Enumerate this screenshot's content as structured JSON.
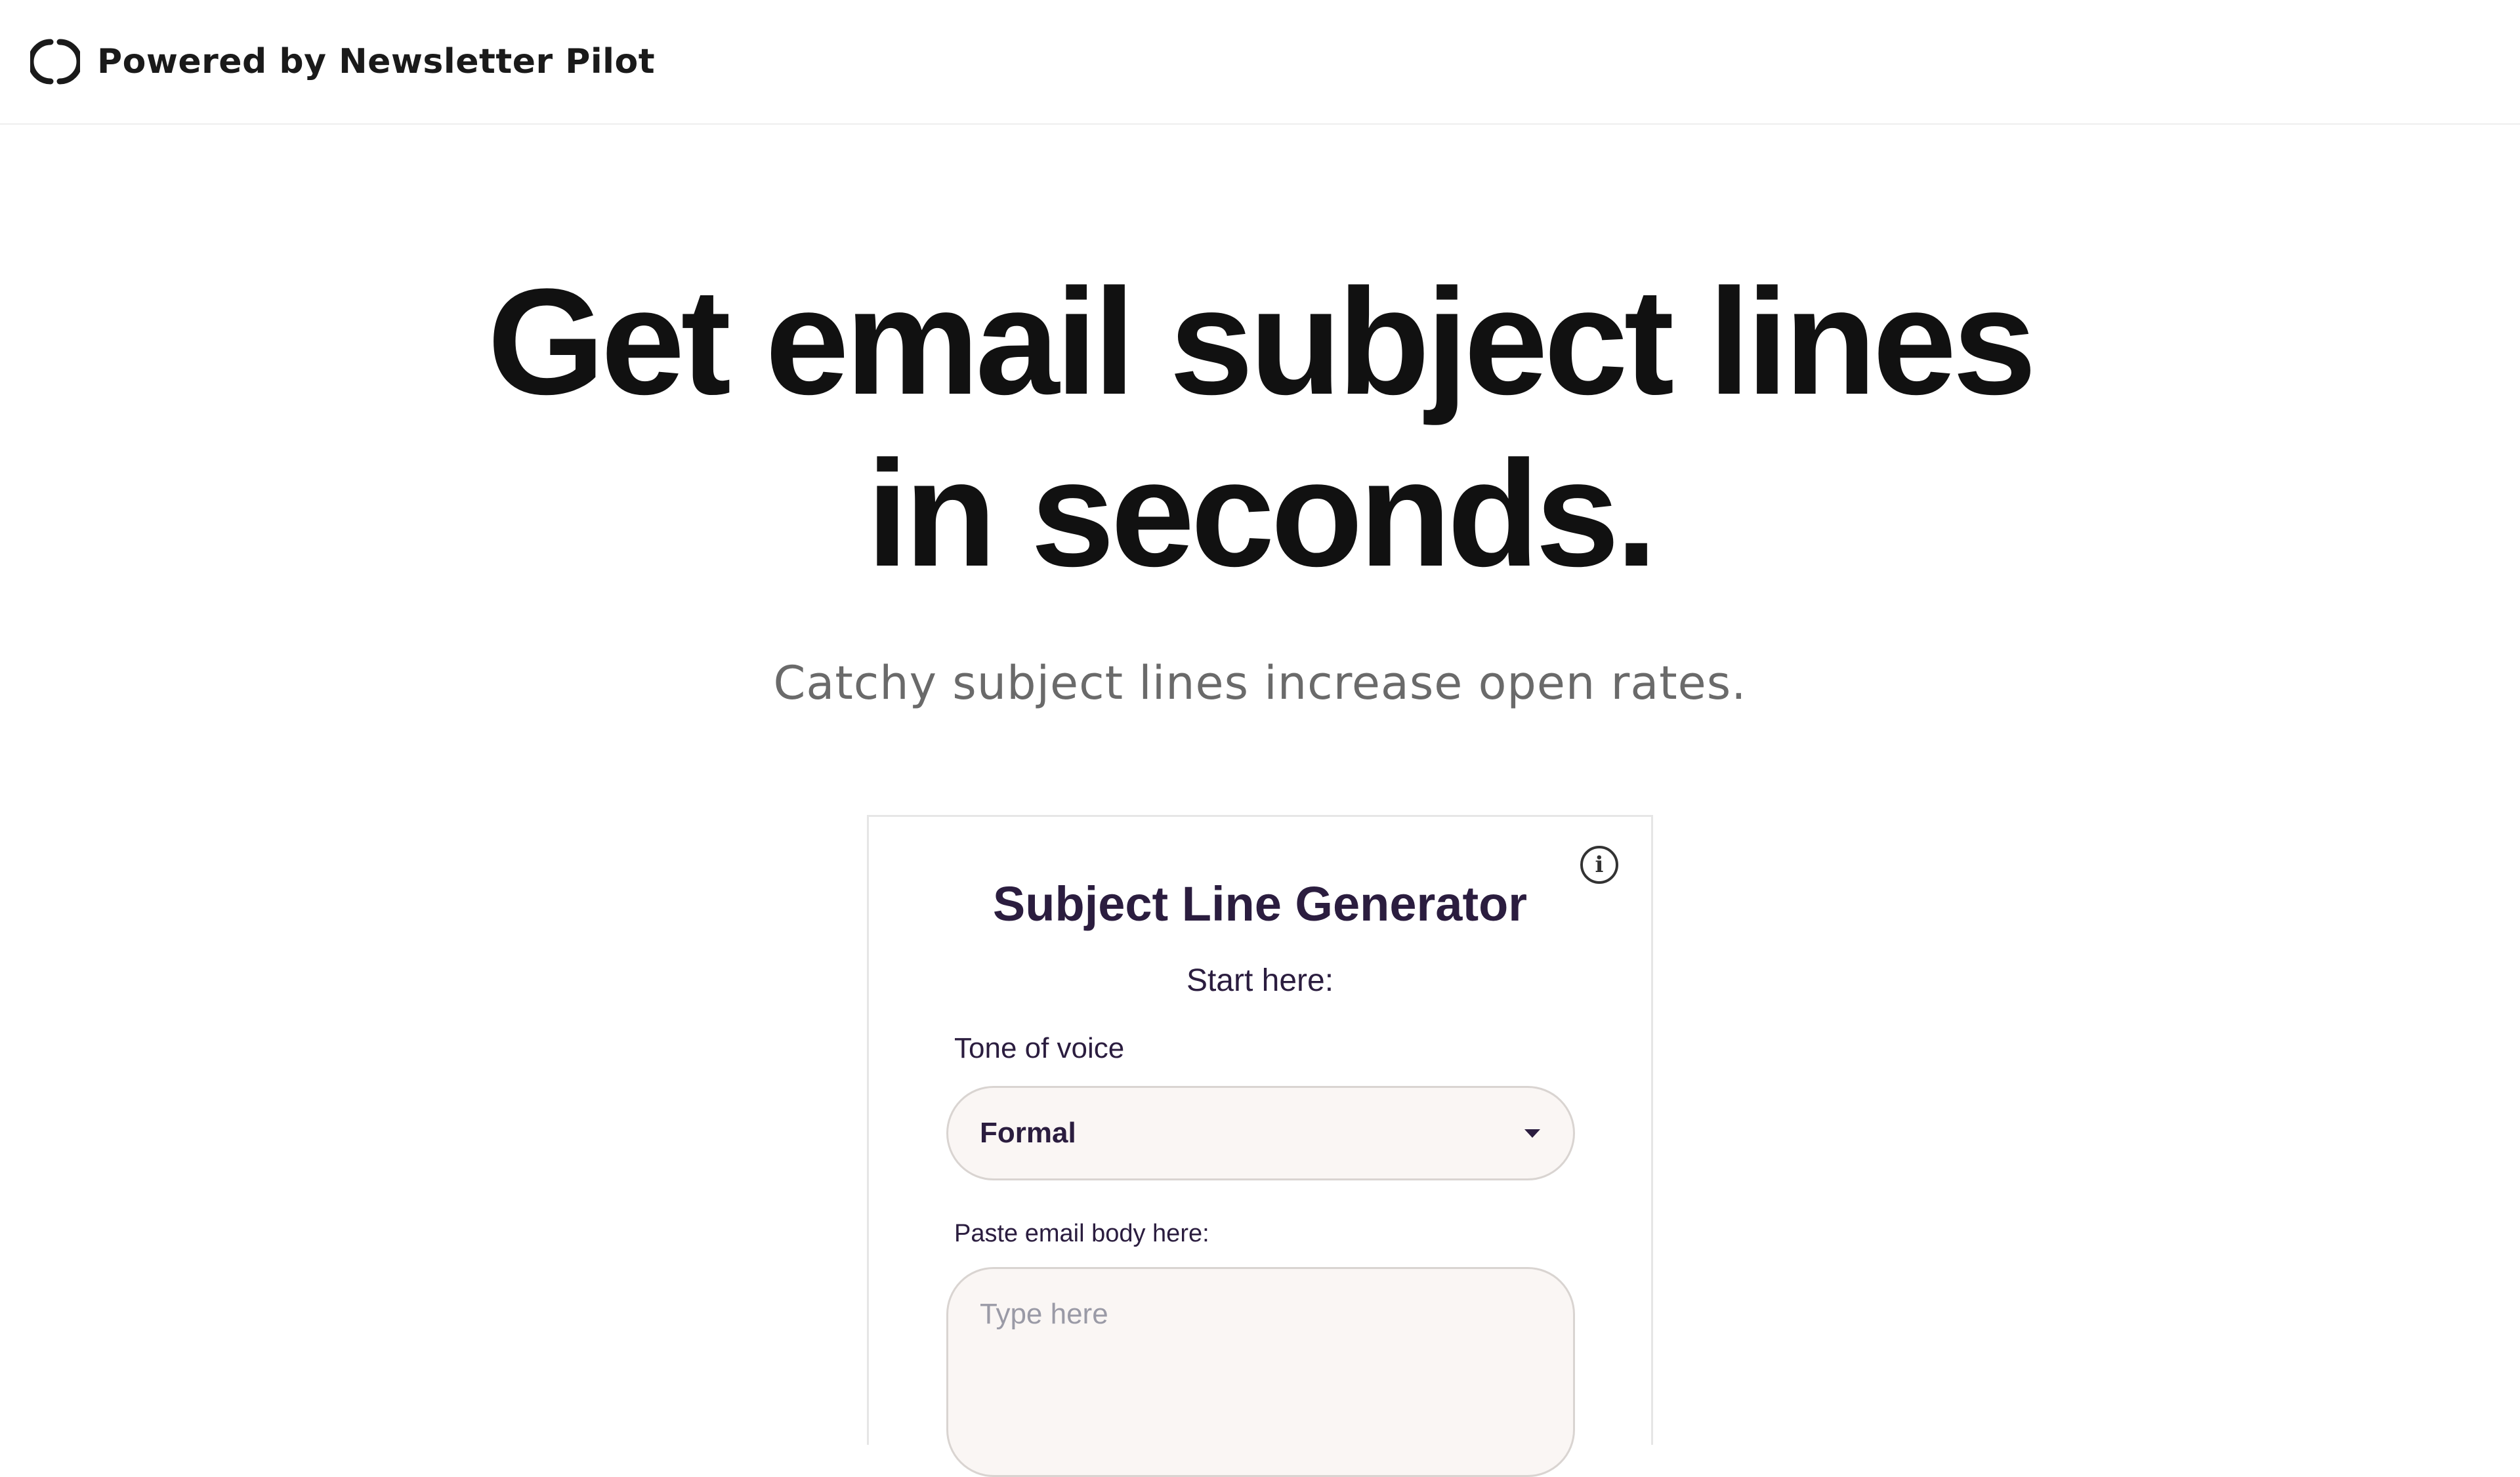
{
  "header": {
    "brand_text": "Powered by Newsletter Pilot",
    "brand_icon": "newsletter-pilot-logo"
  },
  "hero": {
    "title_line1": "Get email subject lines",
    "title_line2": "in seconds.",
    "subtitle": "Catchy subject lines increase open rates."
  },
  "card": {
    "title": "Subject Line Generator",
    "start_here": "Start here:",
    "info_icon": "info-icon",
    "tone": {
      "label": "Tone of voice",
      "value": "Formal"
    },
    "email_body": {
      "label": "Paste email body here:",
      "placeholder": "Type here",
      "value": ""
    }
  },
  "colors": {
    "text_dark": "#111111",
    "accent_purple": "#2b1d3f",
    "subtitle_gray": "#6a6a6a",
    "input_bg": "#faf6f4",
    "input_border": "#d9d4d1"
  }
}
